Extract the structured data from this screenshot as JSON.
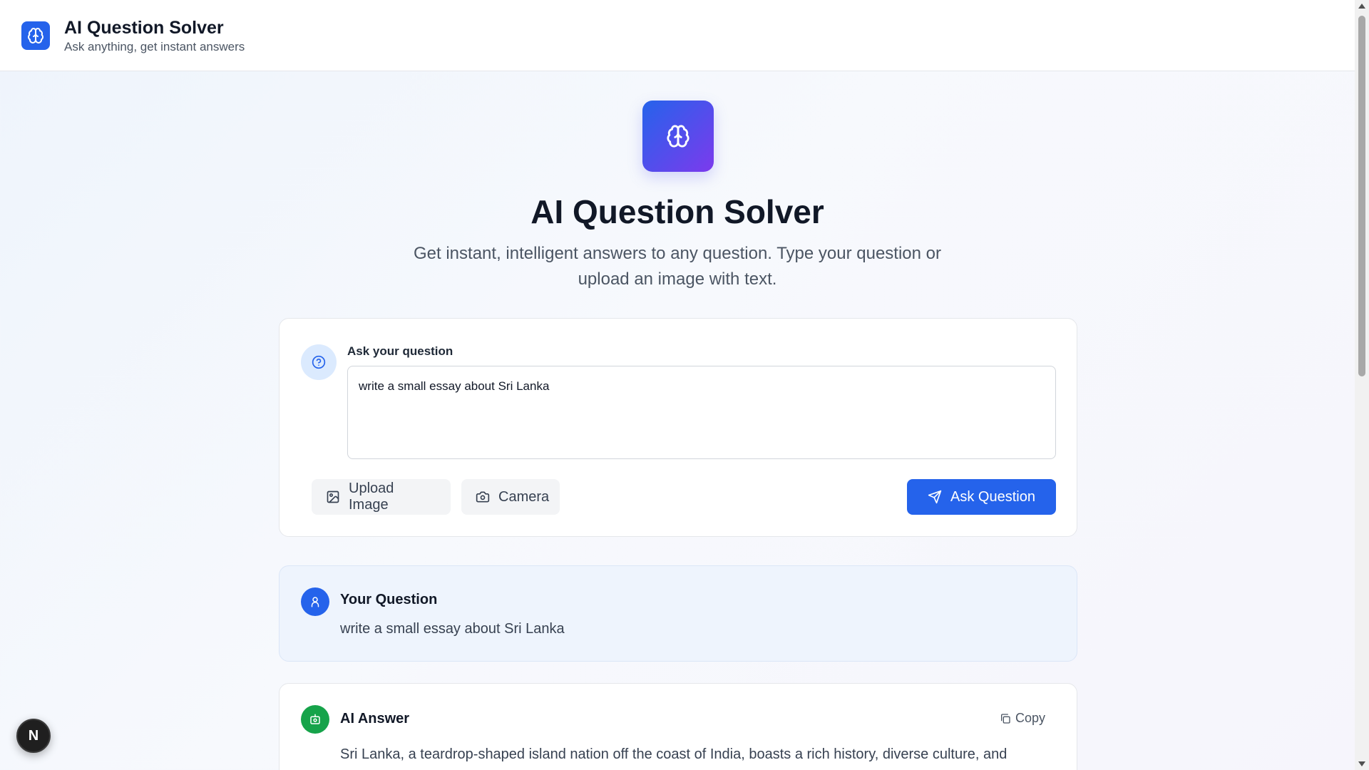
{
  "header": {
    "title": "AI Question Solver",
    "subtitle": "Ask anything, get instant answers",
    "logo_icon": "brain-icon"
  },
  "hero": {
    "icon": "brain-icon",
    "title": "AI Question Solver",
    "description": "Get instant, intelligent answers to any question. Type your question or upload an image with text.",
    "gradient_start": "#2563eb",
    "gradient_end": "#7c3aed"
  },
  "ask": {
    "label": "Ask your question",
    "input_value": "write a small essay about Sri Lanka",
    "upload_label": "Upload Image",
    "camera_label": "Camera",
    "submit_label": "Ask Question",
    "accent": "#2563eb"
  },
  "question": {
    "title": "Your Question",
    "text": "write a small essay about Sri Lanka"
  },
  "answer": {
    "title": "AI Answer",
    "copy_label": "Copy",
    "text": "Sri Lanka, a teardrop-shaped island nation off the coast of India, boasts a rich history, diverse culture, and",
    "accent": "#16a34a"
  },
  "dev_badge": {
    "label": "N"
  }
}
